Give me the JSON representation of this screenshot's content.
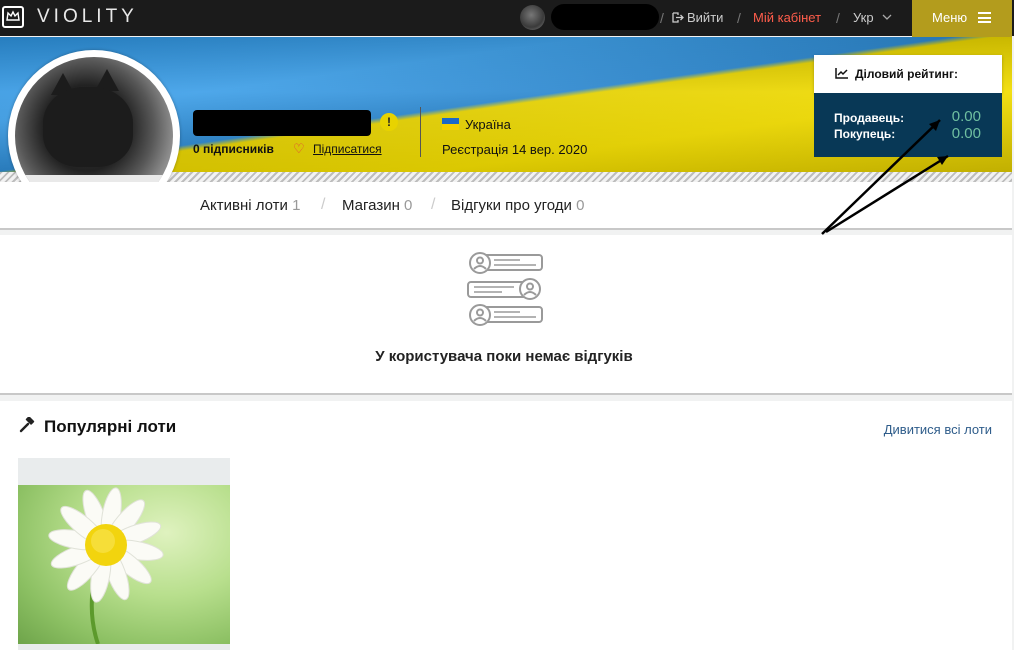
{
  "nav": {
    "logo": "VIOLITY",
    "logout": "Вийти",
    "cabinet": "Мій кабінет",
    "lang": "Укр",
    "menu": "Меню",
    "sep": "/"
  },
  "profile": {
    "followers": "0 підписників",
    "subscribe": "Підписатися",
    "country": "Україна",
    "registered": "Реєстрація 14 вер. 2020",
    "warning": "!"
  },
  "rating": {
    "title": "Діловий рейтинг:",
    "seller_label": "Продавець:",
    "seller_value": "0.00",
    "buyer_label": "Покупець:",
    "buyer_value": "0.00"
  },
  "tabs": [
    {
      "label": "Активні лоти",
      "count": "1"
    },
    {
      "label": "Магазин",
      "count": "0"
    },
    {
      "label": "Відгуки про угоди",
      "count": "0"
    }
  ],
  "reviews": {
    "empty": "У користувача поки немає відгуків"
  },
  "popular": {
    "title": "Популярні лоти",
    "see_all": "Дивитися всі лоти"
  },
  "colors": {
    "nav_bg": "#1b1b1b",
    "menu_bg": "#b39c1d",
    "cabinet": "#ff5d4b",
    "rating_bg": "#083856",
    "rating_value": "#6fbfa1"
  },
  "icons": [
    "logo-icon",
    "logout-icon",
    "chevron-down-icon",
    "menu-icon",
    "warning-icon",
    "heart-icon",
    "flag-ua-icon",
    "chart-icon",
    "reviews-empty-icon",
    "hammer-icon"
  ]
}
